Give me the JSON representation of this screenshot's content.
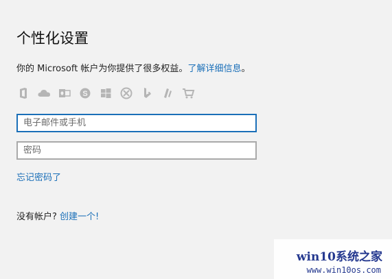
{
  "page": {
    "title": "个性化设置",
    "description_prefix": "你的 Microsoft 帐户为你提供了很多权益。",
    "learn_more_link": "了解详细信息",
    "description_suffix": "。"
  },
  "service_icons": [
    "office-icon",
    "onedrive-icon",
    "outlook-icon",
    "skype-icon",
    "windows-icon",
    "xbox-icon",
    "bing-icon",
    "msn-icon",
    "store-icon"
  ],
  "form": {
    "email_placeholder": "电子邮件或手机",
    "password_placeholder": "密码",
    "forgot_link": "忘记密码了"
  },
  "footer": {
    "no_account_text": "没有帐户?",
    "create_link": "创建一个!"
  },
  "watermark": {
    "line1": "win10系统之家",
    "line2": "www.win10os.com"
  },
  "colors": {
    "accent": "#1a6fb8",
    "background": "#f2f2f2",
    "icon_gray": "#b5b5b5"
  }
}
